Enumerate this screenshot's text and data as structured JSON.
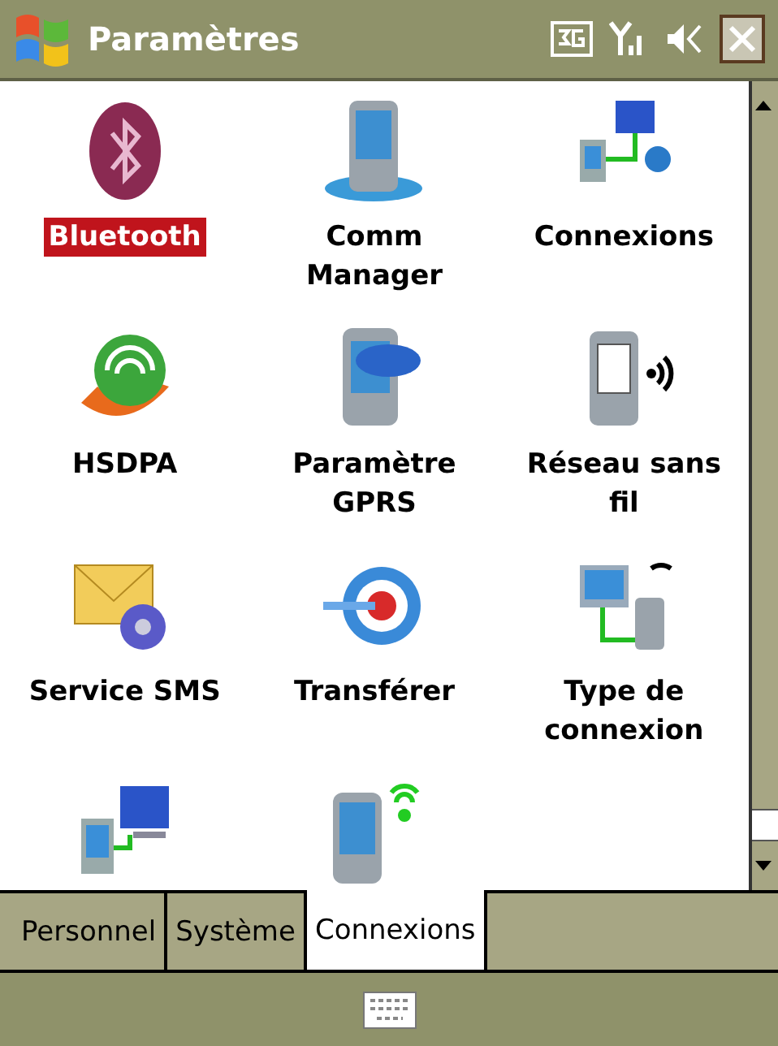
{
  "title_bar": {
    "title": "Paramètres"
  },
  "items": [
    {
      "label": "Bluetooth",
      "selected": true
    },
    {
      "label": "Comm Manager",
      "selected": false
    },
    {
      "label": "Connexions",
      "selected": false
    },
    {
      "label": "HSDPA",
      "selected": false
    },
    {
      "label": "Paramètre GPRS",
      "selected": false
    },
    {
      "label": "Réseau sans fil",
      "selected": false
    },
    {
      "label": "Service SMS",
      "selected": false
    },
    {
      "label": "Transférer",
      "selected": false
    },
    {
      "label": "Type de connexion",
      "selected": false
    },
    {
      "selected": false
    },
    {
      "selected": false
    }
  ],
  "tabs": [
    {
      "label": "Personnel",
      "selected": false
    },
    {
      "label": "Système",
      "selected": false
    },
    {
      "label": "Connexions",
      "selected": true
    }
  ]
}
